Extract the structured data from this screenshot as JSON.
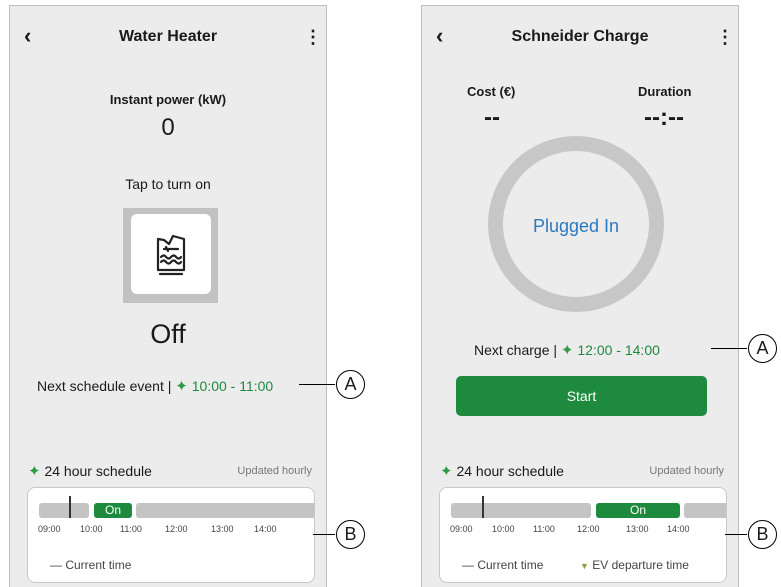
{
  "water_heater": {
    "title": "Water Heater",
    "back_icon": "‹",
    "more_icon": "⋮",
    "instant_power_label": "Instant power (kW)",
    "instant_power_value": "0",
    "tap_hint": "Tap to turn on",
    "state": "Off",
    "next_event_label": "Next schedule event |",
    "next_event_time": "10:00  - 11:00",
    "schedule_title": "24 hour schedule",
    "schedule_updated": "Updated hourly",
    "timeline": {
      "on_label": "On",
      "ticks": [
        "09:00",
        "10:00",
        "11:00",
        "12:00",
        "13:00",
        "14:00"
      ],
      "legend_current": "Current time"
    }
  },
  "schneider_charge": {
    "title": "Schneider Charge",
    "back_icon": "‹",
    "more_icon": "⋮",
    "cost_label": "Cost (€)",
    "cost_value": "--",
    "duration_label": "Duration",
    "duration_value": "--:--",
    "status": "Plugged In",
    "next_charge_label": "Next charge |",
    "next_charge_time": "12:00  - 14:00",
    "start_button": "Start",
    "schedule_title": "24 hour schedule",
    "schedule_updated": "Updated hourly",
    "timeline": {
      "on_label": "On",
      "ticks": [
        "09:00",
        "10:00",
        "11:00",
        "12:00",
        "13:00",
        "14:00"
      ],
      "legend_current": "Current time",
      "legend_departure": "EV departure time"
    }
  },
  "callouts": {
    "a_label": "A",
    "b_label": "B"
  },
  "colors": {
    "accent_green": "#1e8a3e",
    "status_blue": "#2a7ac0",
    "screen_bg": "#ececec"
  },
  "icons": {
    "back": "chevron-left-icon",
    "more": "more-vertical-icon",
    "schedule": "sparkle-icon",
    "water_heater": "water-heater-icon"
  }
}
